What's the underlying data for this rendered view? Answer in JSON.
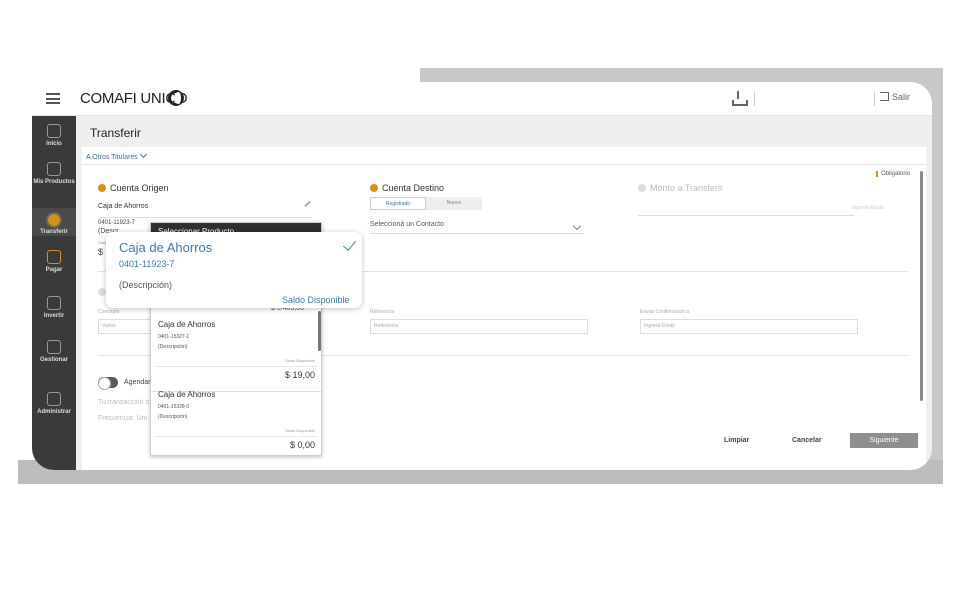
{
  "header": {
    "brand": "COMAFI UNICO",
    "logout_label": "Salir"
  },
  "sidebar": {
    "items": [
      {
        "label": "Inicio"
      },
      {
        "label": "Mis Productos"
      },
      {
        "label": "Transferir"
      },
      {
        "label": "Pagar"
      },
      {
        "label": "Invertir"
      },
      {
        "label": "Gestionar"
      },
      {
        "label": "Administrar"
      }
    ]
  },
  "page": {
    "title": "Transferir",
    "account_selector": "A Otros Titulares",
    "required_note": "Obligatorio"
  },
  "origen": {
    "heading": "Cuenta Origen",
    "name": "Caja de Ahorros",
    "account": "0401-11923-7",
    "desc_partial": "(Descr",
    "saldo_partial": "Saldo",
    "amount_partial": "$ 5,"
  },
  "destino": {
    "heading": "Cuenta Destino",
    "tab_registered": "Registrado",
    "tab_new": "Nuevo",
    "select_placeholder": "Seleccioná un Contacto"
  },
  "monto": {
    "heading": "Monto a Transferir",
    "placeholder": "Ingresá Monto"
  },
  "detail": {
    "section_initial": "D",
    "concepto_label": "Concepto",
    "concepto_value": "Varios",
    "referencia_label": "Referencia",
    "referencia_placeholder": "Referencia",
    "email_label": "Enviar Confirmación a",
    "email_placeholder": "Ingresá Email"
  },
  "schedule": {
    "toggle_label": "Agendar",
    "note": "Tu transacción s",
    "frequency": "Frecuencia: Uni"
  },
  "footer": {
    "clear": "Limpiar",
    "cancel": "Cancelar",
    "next": "Siguiente"
  },
  "dropdown": {
    "header": "Seleccionar Producto",
    "partial_amount": "$ 5.403,00",
    "items": [
      {
        "name": "Caja de Ahorros",
        "account": "0401-15327-1",
        "desc": "(Descripción)",
        "saldo_label": "Saldo Disponible",
        "amount": "$ 19,00"
      },
      {
        "name": "Caja de Ahorros",
        "account": "0401-15328-0",
        "desc": "(Descripción)",
        "saldo_label": "Saldo Disponible",
        "amount": "$ 0,00"
      }
    ]
  },
  "hover_card": {
    "name": "Caja de Ahorros",
    "account": "0401-11923-7",
    "desc": "(Descripción)",
    "saldo_label": "Saldo Disponible"
  },
  "colors": {
    "accent": "#d89012",
    "link": "#3a79b8",
    "sidebar": "#3a3a3a"
  }
}
